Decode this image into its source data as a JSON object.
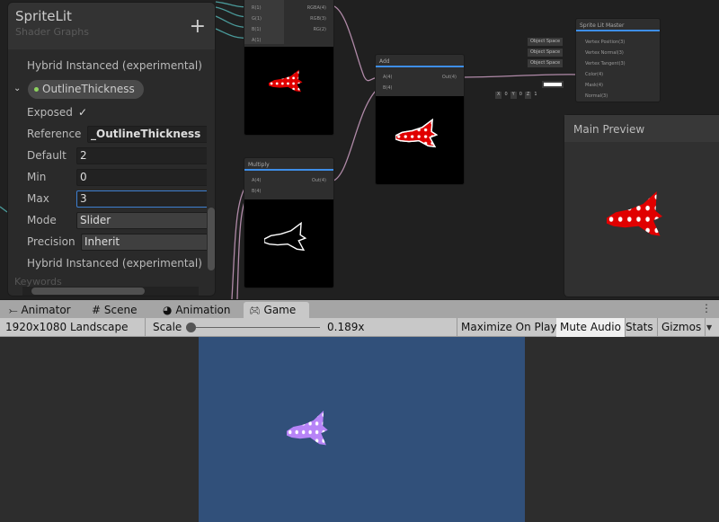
{
  "blackboard": {
    "title": "SpriteLit",
    "subtitle": "Shader Graphs",
    "add_icon": "plus-icon",
    "hybrid_top": "Hybrid Instanced (experimental)",
    "property_name": "OutlineThickness",
    "fields": {
      "exposed_label": "Exposed",
      "exposed": true,
      "reference_label": "Reference",
      "reference": "_OutlineThickness",
      "default_label": "Default",
      "default": "2",
      "min_label": "Min",
      "min": "0",
      "max_label": "Max",
      "max": "3",
      "mode_label": "Mode",
      "mode": "Slider",
      "precision_label": "Precision",
      "precision": "Inherit"
    },
    "hybrid_bottom": "Hybrid Instanced (experimental)",
    "keywords": "Keywords"
  },
  "nodes": {
    "split": {
      "inputs": [
        "R(1)",
        "G(1)",
        "B(1)",
        "A(1)"
      ],
      "outputs": [
        "RGBA(4)",
        "RGB(3)",
        "RG(2)"
      ]
    },
    "multiply": {
      "title": "Multiply",
      "inputs": [
        "A(4)",
        "B(4)"
      ],
      "output": "Out(4)"
    },
    "add": {
      "title": "Add",
      "inputs": [
        "A(4)",
        "B(4)"
      ],
      "output": "Out(4)"
    },
    "master": {
      "title": "Sprite Lit Master",
      "inputs": [
        "Vertex Position(3)",
        "Vertex Normal(3)",
        "Vertex Tangent(3)",
        "Color(4)",
        "Mask(4)",
        "Normal(3)"
      ],
      "space_values": [
        "Object Space",
        "Object Space",
        "Object Space"
      ],
      "normal_xyz": {
        "x_label": "X",
        "x": "0",
        "y_label": "Y",
        "y": "0",
        "z_label": "Z",
        "z": "1"
      }
    }
  },
  "main_preview": {
    "title": "Main Preview"
  },
  "tabs": [
    {
      "label": "Animator",
      "icon": "animator-icon"
    },
    {
      "label": "Scene",
      "icon": "hash-icon"
    },
    {
      "label": "Animation",
      "icon": "clock-icon"
    },
    {
      "label": "Game",
      "icon": "gamepad-icon",
      "active": true
    }
  ],
  "game_toolbar": {
    "resolution": "1920x1080 Landscape (1",
    "scale_label": "Scale",
    "scale_value": "0.189x",
    "maximize": "Maximize On Play",
    "mute": "Mute Audio",
    "mute_active": true,
    "stats": "Stats",
    "gizmos": "Gizmos"
  },
  "colors": {
    "accent": "#3e8ee8",
    "sprite_preview": "#e00000",
    "sprite_game": "#b784f7",
    "game_bg": "#31507a"
  }
}
